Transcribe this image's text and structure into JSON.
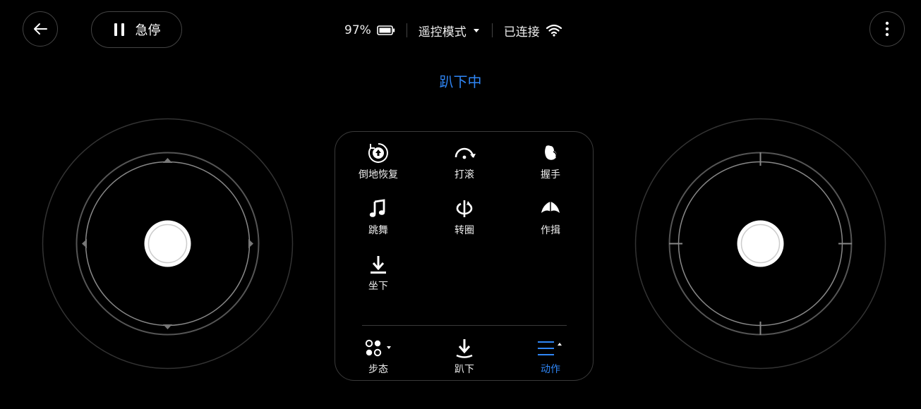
{
  "header": {
    "back_icon": "arrow-left-icon",
    "estop_label": "急停",
    "estop_icon": "pause-icon",
    "battery_percent": "97%",
    "battery_icon": "battery-icon",
    "mode_label": "遥控模式",
    "connection_label": "已连接",
    "wifi_icon": "wifi-icon",
    "more_icon": "more-vertical-icon"
  },
  "state_title": "趴下中",
  "actions": [
    {
      "label": "倒地恢复",
      "icon": "recover-icon"
    },
    {
      "label": "打滚",
      "icon": "roll-icon"
    },
    {
      "label": "握手",
      "icon": "handshake-icon"
    },
    {
      "label": "跳舞",
      "icon": "music-note-icon"
    },
    {
      "label": "转圈",
      "icon": "spin-icon"
    },
    {
      "label": "作揖",
      "icon": "bow-icon"
    },
    {
      "label": "坐下",
      "icon": "sit-down-icon"
    }
  ],
  "tabs": [
    {
      "label": "步态",
      "icon": "gait-icon"
    },
    {
      "label": "趴下",
      "icon": "lie-down-icon"
    },
    {
      "label": "动作",
      "icon": "menu-lines-icon",
      "active": true
    }
  ],
  "colors": {
    "accent": "#2f86f6",
    "background": "#000000"
  }
}
